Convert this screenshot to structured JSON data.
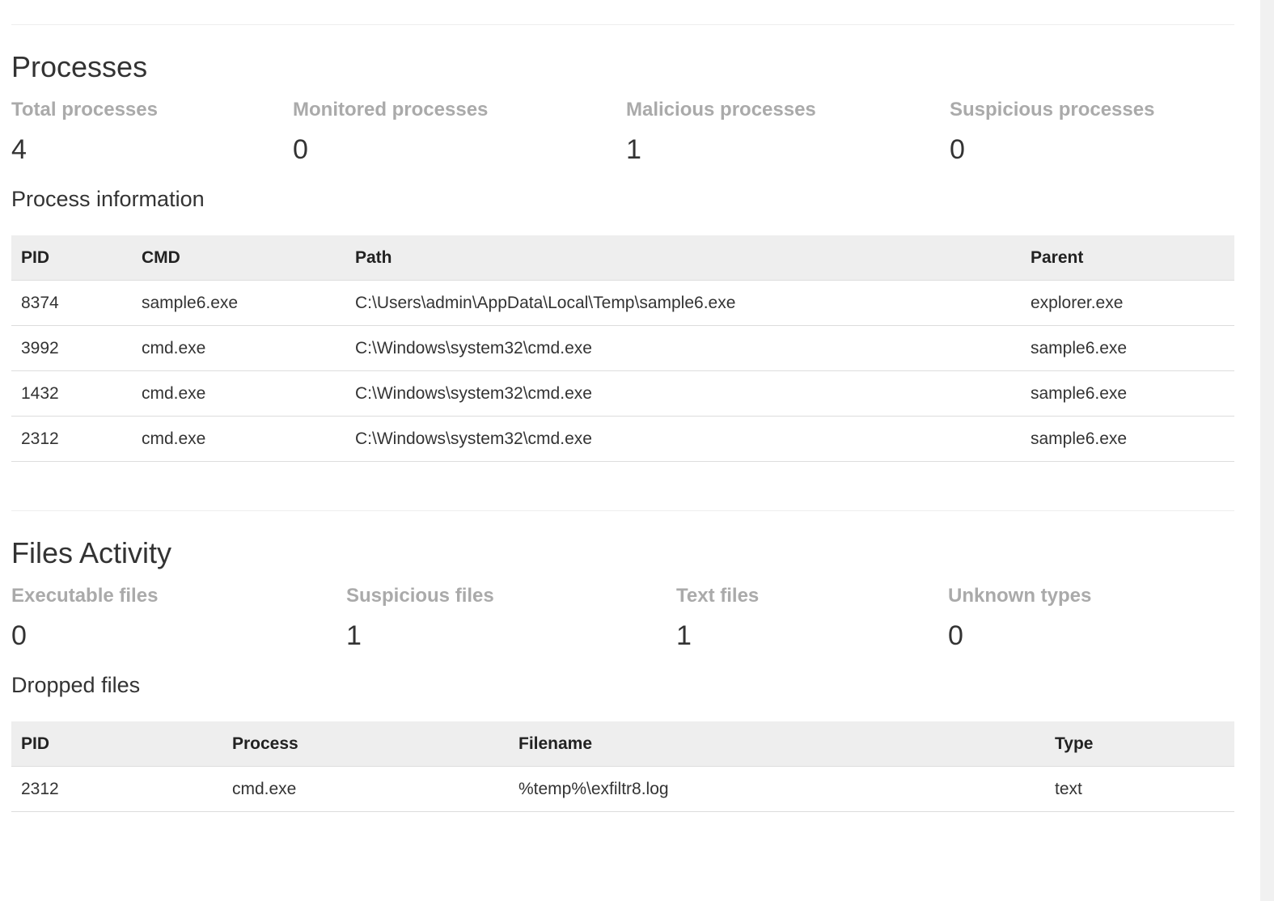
{
  "processes": {
    "title": "Processes",
    "stats": [
      {
        "label": "Total processes",
        "value": "4"
      },
      {
        "label": "Monitored processes",
        "value": "0"
      },
      {
        "label": "Malicious processes",
        "value": "1"
      },
      {
        "label": "Suspicious processes",
        "value": "0"
      }
    ],
    "table_title": "Process information",
    "columns": [
      "PID",
      "CMD",
      "Path",
      "Parent"
    ],
    "rows": [
      [
        "8374",
        "sample6.exe",
        "C:\\Users\\admin\\AppData\\Local\\Temp\\sample6.exe",
        "explorer.exe"
      ],
      [
        "3992",
        "cmd.exe",
        "C:\\Windows\\system32\\cmd.exe",
        "sample6.exe"
      ],
      [
        "1432",
        "cmd.exe",
        "C:\\Windows\\system32\\cmd.exe",
        "sample6.exe"
      ],
      [
        "2312",
        "cmd.exe",
        "C:\\Windows\\system32\\cmd.exe",
        "sample6.exe"
      ]
    ]
  },
  "files": {
    "title": "Files Activity",
    "stats": [
      {
        "label": "Executable files",
        "value": "0"
      },
      {
        "label": "Suspicious files",
        "value": "1"
      },
      {
        "label": "Text files",
        "value": "1"
      },
      {
        "label": "Unknown types",
        "value": "0"
      }
    ],
    "table_title": "Dropped files",
    "columns": [
      "PID",
      "Process",
      "Filename",
      "Type"
    ],
    "rows": [
      [
        "2312",
        "cmd.exe",
        "%temp%\\exfiltr8.log",
        "text"
      ]
    ]
  }
}
